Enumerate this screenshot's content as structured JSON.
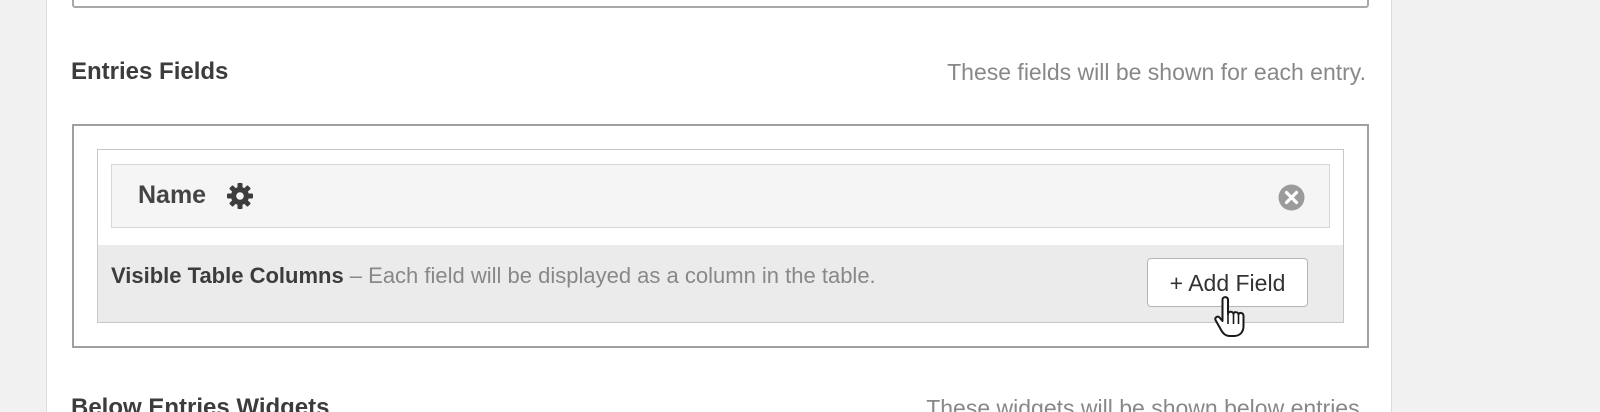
{
  "section_entries": {
    "title": "Entries Fields",
    "description": "These fields will be shown for each entry."
  },
  "field": {
    "name": "Name",
    "settings_icon": "gear-icon",
    "remove_icon": "close-circle-icon"
  },
  "columns": {
    "label": "Visible Table Columns",
    "description": " – Each field will be displayed as a column in the table."
  },
  "add_field_button": {
    "label": "+ Add Field"
  },
  "section_below": {
    "title": "Below Entries Widgets",
    "description": "These widgets will be shown below entries."
  },
  "colors": {
    "background": "#f1f1f1",
    "panel": "#ffffff",
    "heading": "#3c3c3c",
    "muted_text": "#888888",
    "dropzone": "#ebebeb"
  }
}
